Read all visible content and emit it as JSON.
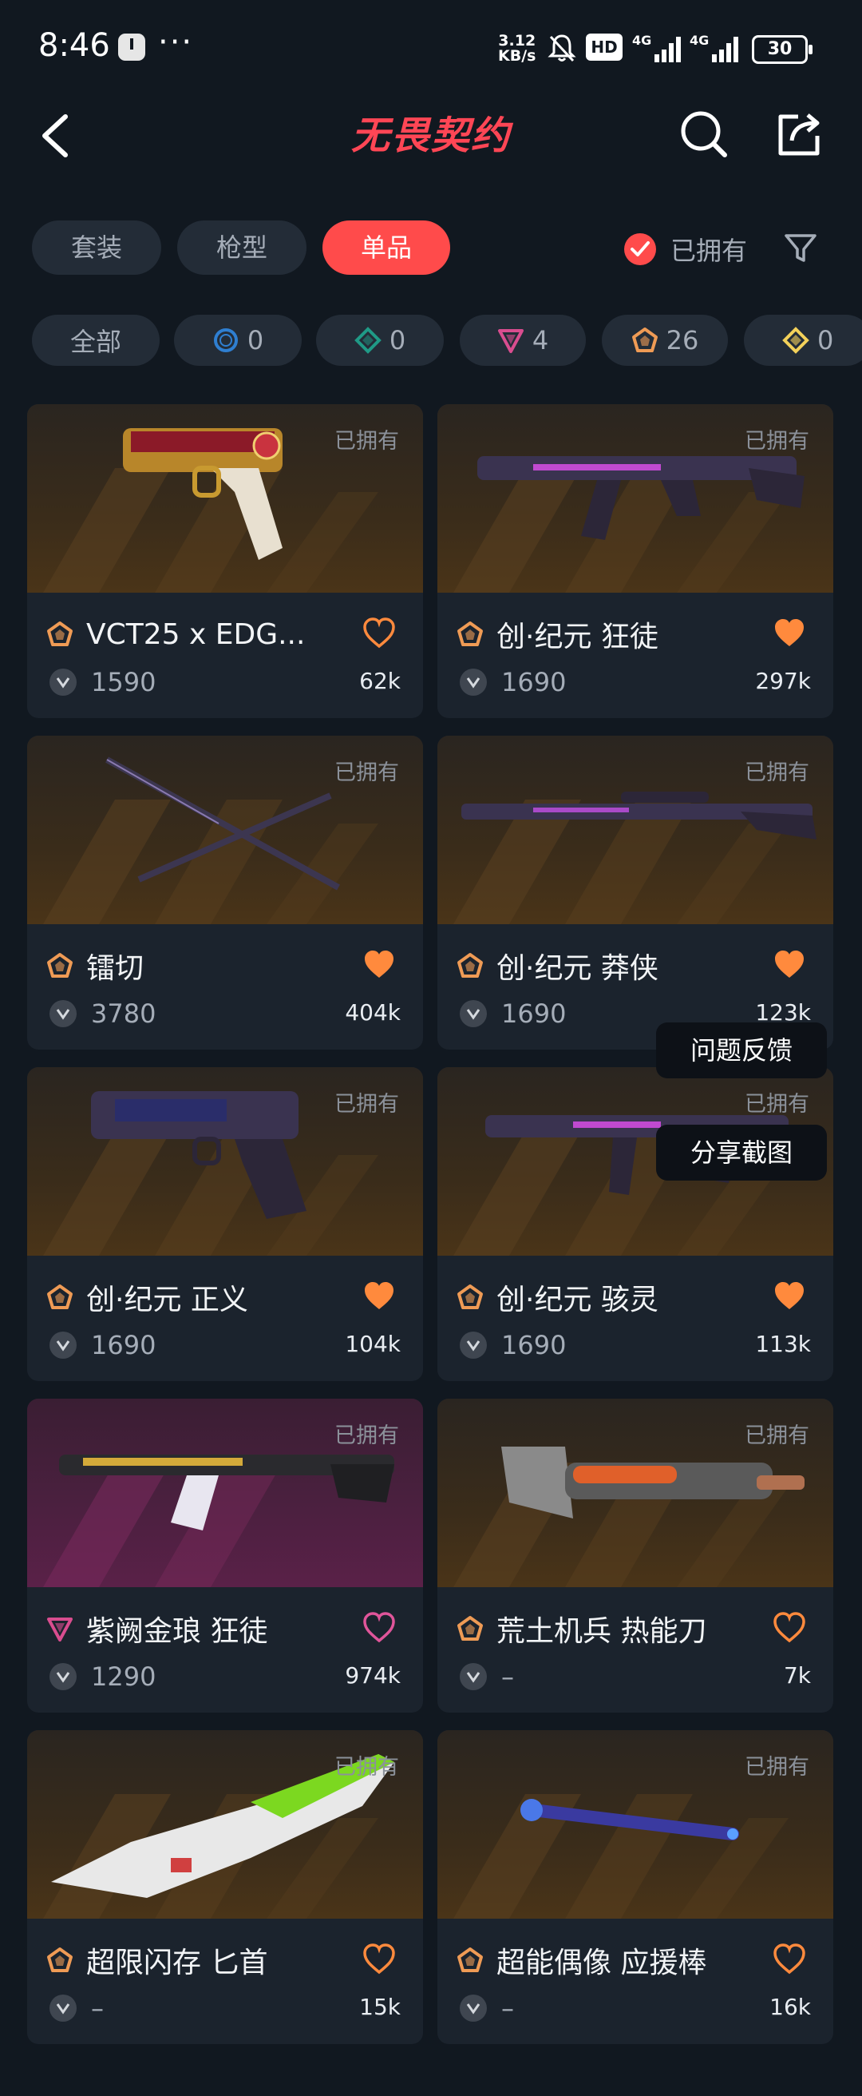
{
  "status": {
    "time": "8:46",
    "dots": "···",
    "speed_value": "3.12",
    "speed_unit": "KB/s",
    "hd": "HD",
    "net1": "4G",
    "net2": "4G",
    "battery": "30"
  },
  "header": {
    "title": "无畏契约"
  },
  "tabs": [
    {
      "label": "套装",
      "active": false
    },
    {
      "label": "枪型",
      "active": false
    },
    {
      "label": "单品",
      "active": true
    }
  ],
  "owned_filter": {
    "label": "已拥有",
    "checked": true
  },
  "rarity_chips": [
    {
      "label": "全部",
      "icon": "all"
    },
    {
      "label": "0",
      "icon": "select-tier-icon",
      "color": "#2f7fd1"
    },
    {
      "label": "0",
      "icon": "deluxe-tier-icon",
      "color": "#1f9a86"
    },
    {
      "label": "4",
      "icon": "premium-tier-icon",
      "color": "#d94d8f"
    },
    {
      "label": "26",
      "icon": "exclusive-tier-icon",
      "color": "#ef9b55"
    },
    {
      "label": "0",
      "icon": "ultra-tier-icon",
      "color": "#f3d15a"
    }
  ],
  "cards": [
    {
      "owned": "已拥有",
      "name": "VCT25 x EDG...",
      "price": "1590",
      "likes": "62k",
      "tier": "exclusive",
      "liked": false
    },
    {
      "owned": "已拥有",
      "name": "创·纪元 狂徒",
      "price": "1690",
      "likes": "297k",
      "tier": "exclusive",
      "liked": true
    },
    {
      "owned": "已拥有",
      "name": "镭切",
      "price": "3780",
      "likes": "404k",
      "tier": "exclusive",
      "liked": true
    },
    {
      "owned": "已拥有",
      "name": "创·纪元 莽侠",
      "price": "1690",
      "likes": "123k",
      "tier": "exclusive",
      "liked": true
    },
    {
      "owned": "已拥有",
      "name": "创·纪元 正义",
      "price": "1690",
      "likes": "104k",
      "tier": "exclusive",
      "liked": true
    },
    {
      "owned": "已拥有",
      "name": "创·纪元 骇灵",
      "price": "1690",
      "likes": "113k",
      "tier": "exclusive",
      "liked": true
    },
    {
      "owned": "已拥有",
      "name": "紫阙金琅 狂徒",
      "price": "1290",
      "likes": "974k",
      "tier": "premium",
      "liked": false
    },
    {
      "owned": "已拥有",
      "name": "荒土机兵 热能刀",
      "price": "–",
      "likes": "7k",
      "tier": "exclusive",
      "liked": false
    },
    {
      "owned": "已拥有",
      "name": "超限闪存 匕首",
      "price": "–",
      "likes": "15k",
      "tier": "exclusive",
      "liked": false
    },
    {
      "owned": "已拥有",
      "name": "超能偶像 应援棒",
      "price": "–",
      "likes": "16k",
      "tier": "exclusive",
      "liked": false
    }
  ],
  "floating": {
    "feedback": "问题反馈",
    "screenshot": "分享截图"
  },
  "colors": {
    "accent": "#ff4b4b",
    "heart_orange": "#ff8a3d",
    "heart_pink": "#e0559a",
    "exclusive": "#ef9b55",
    "premium": "#d94d8f"
  }
}
